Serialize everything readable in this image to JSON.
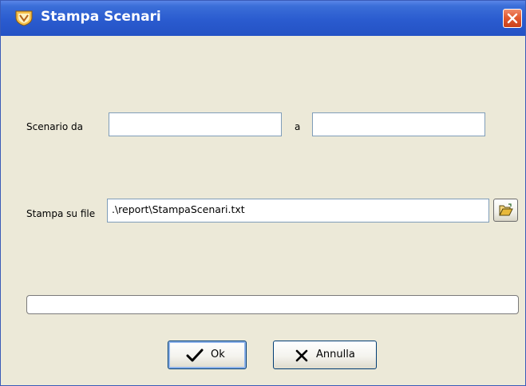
{
  "window": {
    "title": "Stampa Scenari"
  },
  "form": {
    "scenario_label": "Scenario da",
    "scenario_from_value": "",
    "range_separator": "a",
    "scenario_to_value": "",
    "file_label": "Stampa su file",
    "file_value": ".\\report\\StampaScenari.txt"
  },
  "progress": {
    "value_fraction": 0
  },
  "buttons": {
    "ok_label": "Ok",
    "cancel_label": "Annulla"
  },
  "icons": {
    "title": "app-shield-icon",
    "close": "close-icon",
    "browse": "open-folder-icon",
    "ok": "checkmark-icon",
    "cancel": "x-icon"
  },
  "colors": {
    "titlebar": "#2a5bcf",
    "dialog_background": "#ece9d8",
    "close_button": "#e25a30"
  }
}
